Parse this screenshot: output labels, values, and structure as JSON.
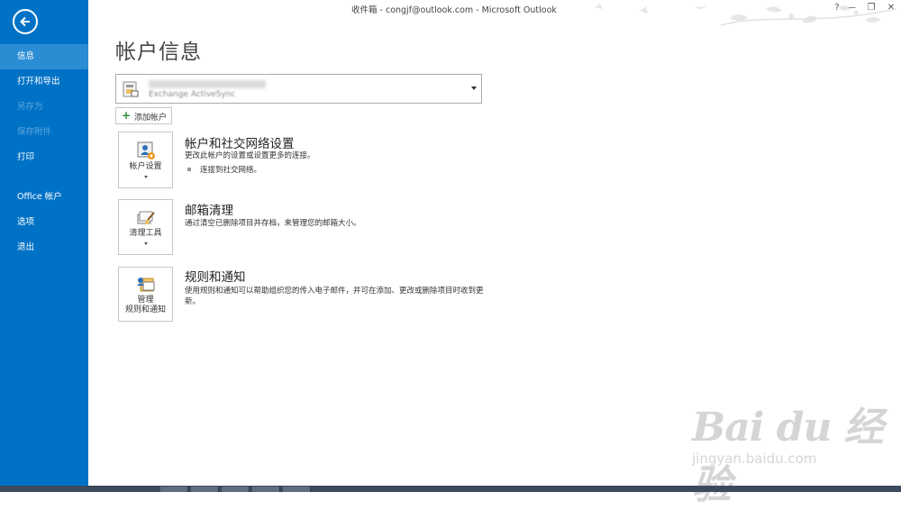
{
  "window": {
    "title": "收件箱 - congjf@outlook.com - Microsoft Outlook",
    "help": "?",
    "minimize": "—",
    "restore": "❐",
    "close": "✕"
  },
  "sidebar": {
    "back_icon": "back-arrow-icon",
    "items": [
      {
        "label": "信息",
        "state": "active"
      },
      {
        "label": "打开和导出",
        "state": "normal"
      },
      {
        "label": "另存为",
        "state": "disabled"
      },
      {
        "label": "保存附件",
        "state": "disabled"
      },
      {
        "label": "打印",
        "state": "normal"
      },
      {
        "label": "Office 帐户",
        "state": "normal"
      },
      {
        "label": "选项",
        "state": "normal"
      },
      {
        "label": "退出",
        "state": "normal"
      }
    ]
  },
  "main": {
    "page_title": "帐户信息",
    "account_selector": {
      "type_text": "Exchange ActiveSync",
      "icon": "exchange-account-icon"
    },
    "add_account_label": "添加帐户",
    "sections": [
      {
        "tile_label": "帐户设置",
        "has_dropdown": true,
        "icon": "account-settings-icon",
        "title": "帐户和社交网络设置",
        "description": "更改此帐户的设置或设置更多的连接。",
        "bullets": [
          "连接到社交网络。"
        ]
      },
      {
        "tile_label": "清理工具",
        "has_dropdown": true,
        "icon": "cleanup-tools-icon",
        "title": "邮箱清理",
        "description": "通过清空已删除项目并存档，来管理您的邮箱大小。"
      },
      {
        "tile_label_line1": "管理",
        "tile_label_line2": "规则和通知",
        "has_dropdown": false,
        "icon": "rules-alerts-icon",
        "title": "规则和通知",
        "description": "使用规则和通知可以帮助组织您的传入电子邮件，并可在添加、更改或删除项目时收到更新。"
      }
    ]
  },
  "watermark": {
    "logo": "Bai du 经验",
    "url": "jingyan.baidu.com"
  },
  "colors": {
    "sidebar_bg": "#0072c6",
    "sidebar_active": "#2a8dd4",
    "sidebar_disabled_text": "#5fa4dc"
  }
}
